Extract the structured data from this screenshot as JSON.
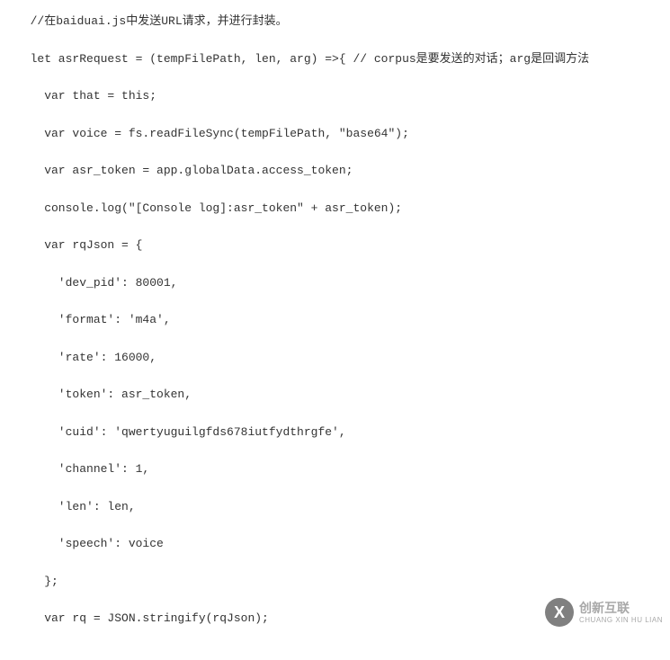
{
  "code": {
    "lines": [
      "  //在baiduai.js中发送URL请求，并进行封装。",
      "  let asrRequest = (tempFilePath, len, arg) =>{ // corpus是要发送的对话；arg是回调方法",
      "    var that = this;",
      "    var voice = fs.readFileSync(tempFilePath, \"base64\");",
      "    var asr_token = app.globalData.access_token;",
      "    console.log(\"[Console log]:asr_token\" + asr_token);",
      "    var rqJson = {",
      "      'dev_pid': 80001,",
      "      'format': 'm4a',",
      "      'rate': 16000,",
      "      'token': asr_token,",
      "      'cuid': 'qwertyuguilgfds678iutfydthrgfe',",
      "      'channel': 1,",
      "      'len': len,",
      "      'speech': voice",
      "    };",
      "    var rq = JSON.stringify(rqJson);"
    ]
  },
  "watermark": {
    "icon_letter": "X",
    "main_text": "创新互联",
    "sub_text": "CHUANG XIN HU LIAN"
  }
}
